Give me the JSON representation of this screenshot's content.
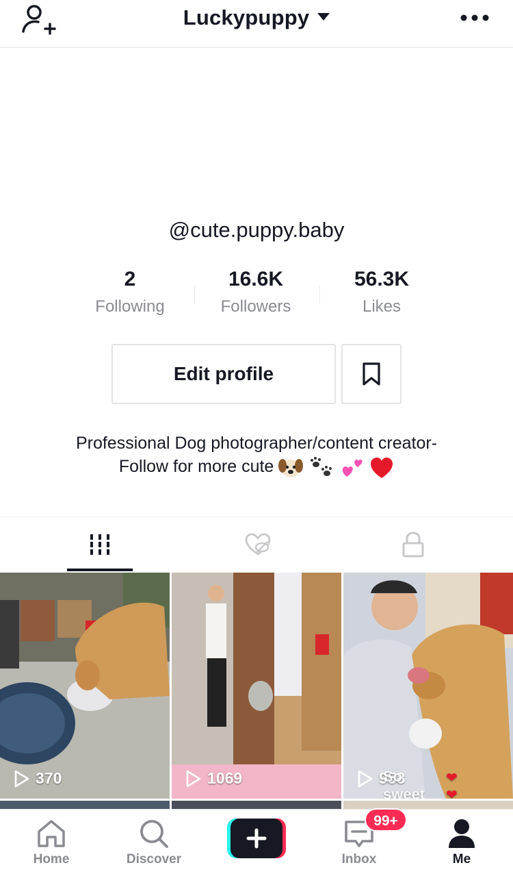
{
  "header": {
    "title": "Luckypuppy"
  },
  "profile": {
    "handle": "@cute.puppy.baby",
    "stats": [
      {
        "value": "2",
        "label": "Following"
      },
      {
        "value": "16.6K",
        "label": "Followers"
      },
      {
        "value": "56.3K",
        "label": "Likes"
      }
    ],
    "edit_label": "Edit profile",
    "bio_line1": "Professional Dog photographer/content creator-",
    "bio_line2": "Follow for more cute"
  },
  "tabs": [
    {
      "icon": "videos-grid-icon",
      "active": true
    },
    {
      "icon": "liked-hidden-icon",
      "active": false
    },
    {
      "icon": "private-lock-icon",
      "active": false
    }
  ],
  "videos": [
    {
      "views": "370",
      "overlay_text": ""
    },
    {
      "views": "1069",
      "overlay_text": ""
    },
    {
      "views": "958",
      "overlay_text": "So sweet"
    }
  ],
  "nav": {
    "items": [
      {
        "label": "Home",
        "icon": "home-icon"
      },
      {
        "label": "Discover",
        "icon": "search-icon"
      },
      {
        "label": "",
        "icon": "create-plus-icon"
      },
      {
        "label": "Inbox",
        "icon": "inbox-icon"
      },
      {
        "label": "Me",
        "icon": "profile-icon"
      }
    ],
    "inbox_badge": "99+"
  },
  "colors": {
    "accent": "#fe2c55",
    "cyan": "#25f4ee",
    "text": "#161823",
    "muted": "#8a8b91"
  }
}
